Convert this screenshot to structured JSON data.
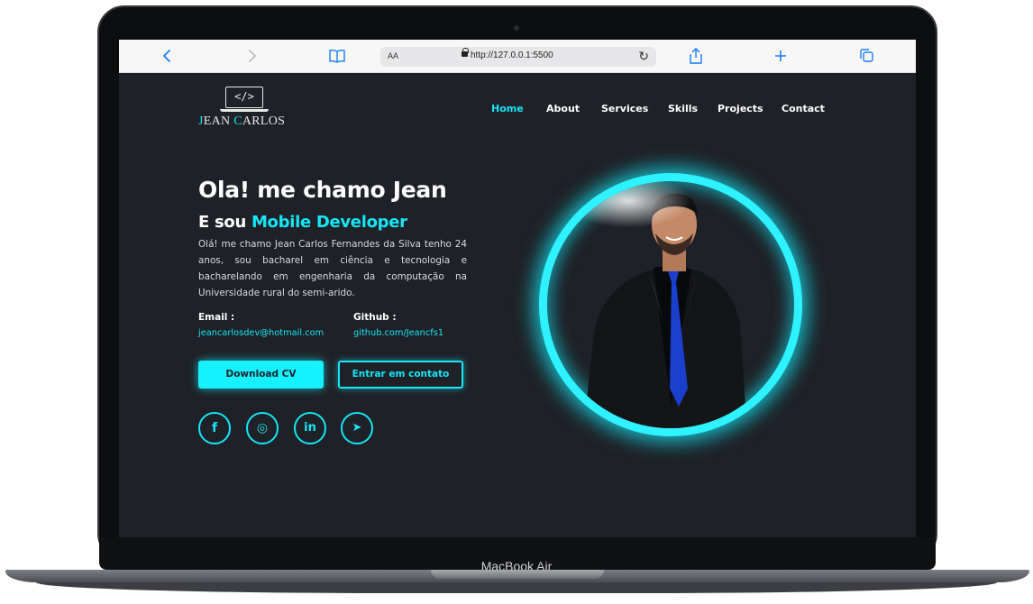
{
  "device": {
    "model_label": "MacBook Air"
  },
  "browser": {
    "url_aa": "AA",
    "url": "http://127.0.0.1:5500"
  },
  "site": {
    "logo": {
      "mark": "</>",
      "name_first": "J",
      "name_mid": "EAN ",
      "name_c": "C",
      "name_rest": "ARLOS"
    },
    "nav": {
      "home": "Home",
      "about": "About",
      "services": "Services",
      "skills": "Skills",
      "projects": "Projects",
      "contact": "Contact"
    },
    "hero": {
      "title": "Ola! me chamo Jean",
      "subtitle_prefix": "E sou ",
      "subtitle_role": "Mobile Developer",
      "description": "Olá! me chamo Jean Carlos Fernandes da Silva tenho 24 anos, sou bacharel em ciência e tecnologia e bacharelando em engenharia da computação na Universidade rural do semi-arido.",
      "email_label": "Email :",
      "email_value": "jeancarlosdev@hotmail.com",
      "github_label": "Github :",
      "github_value": "github.com/Jeancfs1",
      "download_cv": "Download CV",
      "contact_button": "Entrar em contato"
    },
    "social": {
      "facebook": "f",
      "instagram": "◎",
      "linkedin": "in",
      "telegram": "➤"
    },
    "accent_color": "#16e6f5",
    "background_color": "#1e2127"
  }
}
